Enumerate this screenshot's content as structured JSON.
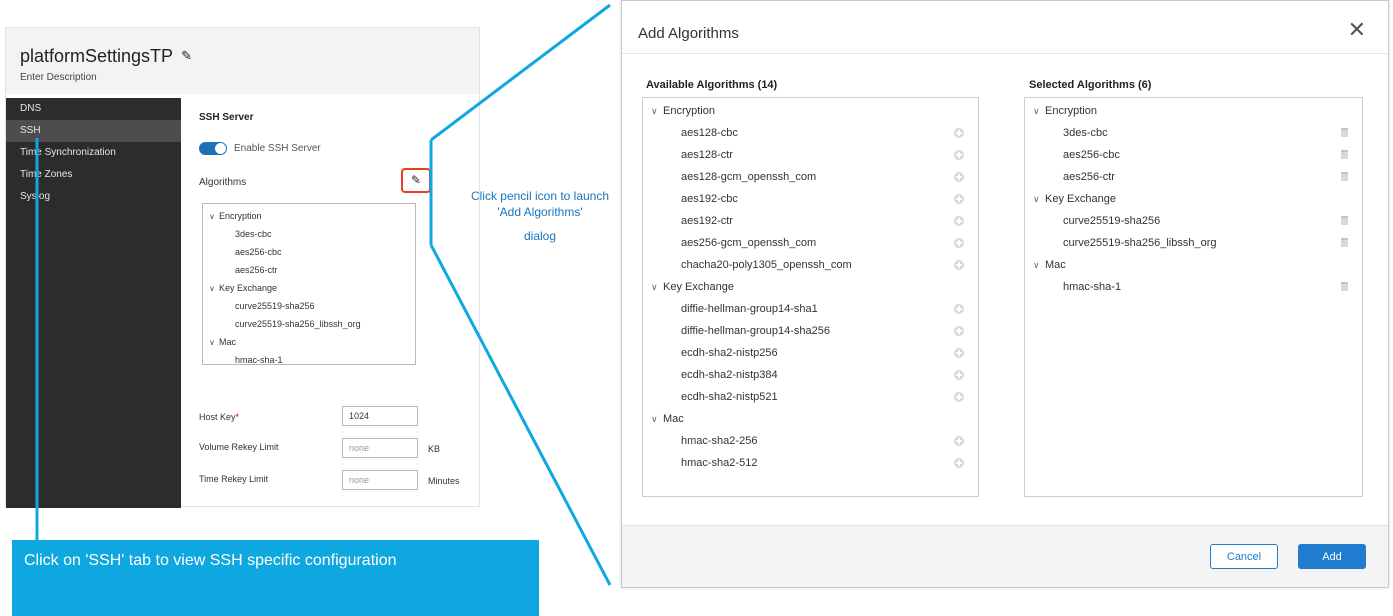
{
  "settings": {
    "title": "platformSettingsTP",
    "description": "Enter Description",
    "nav": [
      {
        "label": "DNS"
      },
      {
        "label": "SSH"
      },
      {
        "label": "Time Synchronization"
      },
      {
        "label": "Time Zones"
      },
      {
        "label": "Syslog"
      }
    ],
    "active_nav": "SSH",
    "ssh": {
      "section_title": "SSH Server",
      "toggle_label": "Enable SSH Server",
      "toggle_on": true,
      "algorithms_label": "Algorithms",
      "tree": [
        {
          "group": "Encryption",
          "items": [
            "3des-cbc",
            "aes256-cbc",
            "aes256-ctr"
          ]
        },
        {
          "group": "Key Exchange",
          "items": [
            "curve25519-sha256",
            "curve25519-sha256_libssh_org"
          ]
        },
        {
          "group": "Mac",
          "items": [
            "hmac-sha-1"
          ]
        }
      ],
      "host_key_label": "Host Key",
      "host_key_required": "*",
      "host_key_value": "1024",
      "volume_label": "Volume Rekey Limit",
      "volume_placeholder": "none",
      "volume_unit": "KB",
      "time_label": "Time Rekey Limit",
      "time_placeholder": "none",
      "time_unit": "Minutes"
    }
  },
  "callouts": {
    "ssh_tab": "Click on 'SSH' tab to view SSH specific configuration",
    "pencil_line1": "Click pencil icon to launch 'Add Algorithms'",
    "pencil_line2": "dialog",
    "color": "#0fa7e0"
  },
  "dialog": {
    "title": "Add Algorithms",
    "available_heading": "Available Algorithms (14)",
    "selected_heading": "Selected Algorithms (6)",
    "available": [
      {
        "group": "Encryption",
        "items": [
          "aes128-cbc",
          "aes128-ctr",
          "aes128-gcm_openssh_com",
          "aes192-cbc",
          "aes192-ctr",
          "aes256-gcm_openssh_com",
          "chacha20-poly1305_openssh_com"
        ]
      },
      {
        "group": "Key Exchange",
        "items": [
          "diffie-hellman-group14-sha1",
          "diffie-hellman-group14-sha256",
          "ecdh-sha2-nistp256",
          "ecdh-sha2-nistp384",
          "ecdh-sha2-nistp521"
        ]
      },
      {
        "group": "Mac",
        "items": [
          "hmac-sha2-256",
          "hmac-sha2-512"
        ]
      }
    ],
    "selected": [
      {
        "group": "Encryption",
        "items": [
          "3des-cbc",
          "aes256-cbc",
          "aes256-ctr"
        ]
      },
      {
        "group": "Key Exchange",
        "items": [
          "curve25519-sha256",
          "curve25519-sha256_libssh_org"
        ]
      },
      {
        "group": "Mac",
        "items": [
          "hmac-sha-1"
        ]
      }
    ],
    "cancel_label": "Cancel",
    "add_label": "Add",
    "accent": "#1f7ccf"
  }
}
